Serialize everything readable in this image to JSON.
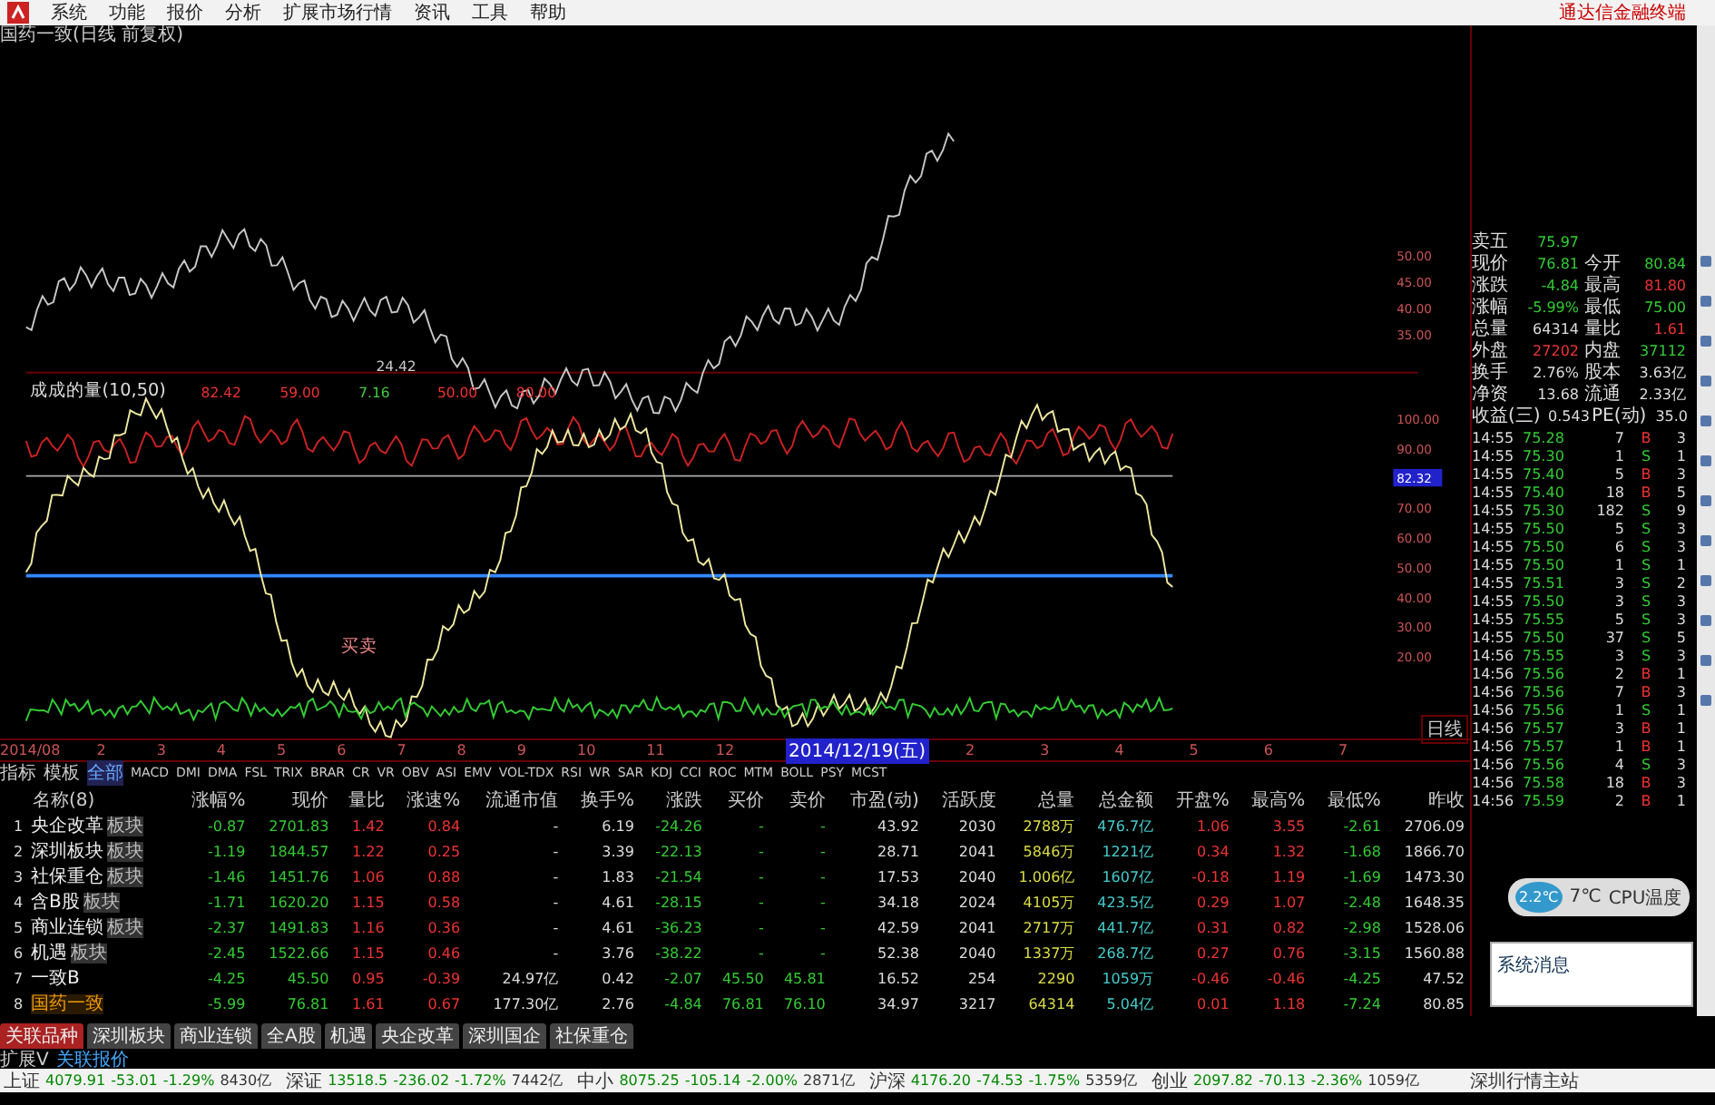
{
  "menu": {
    "items": [
      "系统",
      "功能",
      "报价",
      "分析",
      "扩展市场行情",
      "资讯",
      "工具",
      "帮助"
    ],
    "brand": "通达信金融终端"
  },
  "chart": {
    "title": "国药一致(日线 前复权)",
    "low_label": "24.42",
    "indicator_header": "成成的量(10,50)",
    "indicator_values": [
      "82.42",
      "59.00",
      "7.16",
      "50.00",
      "80.00"
    ],
    "signal_label": "买卖",
    "price_axis": [
      "50.00",
      "45.00",
      "40.00",
      "35.00"
    ],
    "indicator_axis": [
      {
        "label": "100.00",
        "current": false
      },
      {
        "label": "90.00",
        "current": false
      },
      {
        "label": "82.32",
        "current": true
      },
      {
        "label": "70.00",
        "current": false
      },
      {
        "label": "60.00",
        "current": false
      },
      {
        "label": "50.00",
        "current": false
      },
      {
        "label": "40.00",
        "current": false
      },
      {
        "label": "30.00",
        "current": false
      },
      {
        "label": "20.00",
        "current": false
      }
    ],
    "period_label": "日线"
  },
  "date_axis": {
    "start": "2014/08",
    "marks": [
      "2",
      "3",
      "4",
      "5",
      "6",
      "7",
      "8",
      "9",
      "10",
      "11",
      "12"
    ],
    "cursor_date": "2014/12/19(五)",
    "after": [
      "2",
      "3",
      "4",
      "5",
      "6",
      "7"
    ]
  },
  "indicator_tabs": [
    {
      "label": "指标",
      "selected": false
    },
    {
      "label": "模板",
      "selected": false
    },
    {
      "label": "全部",
      "selected": true
    },
    {
      "label": "MACD",
      "selected": false
    },
    {
      "label": "DMI",
      "selected": false
    },
    {
      "label": "DMA",
      "selected": false
    },
    {
      "label": "FSL",
      "selected": false
    },
    {
      "label": "TRIX",
      "selected": false
    },
    {
      "label": "BRAR",
      "selected": false
    },
    {
      "label": "CR",
      "selected": false
    },
    {
      "label": "VR",
      "selected": false
    },
    {
      "label": "OBV",
      "selected": false
    },
    {
      "label": "ASI",
      "selected": false
    },
    {
      "label": "EMV",
      "selected": false
    },
    {
      "label": "VOL-TDX",
      "selected": false
    },
    {
      "label": "RSI",
      "selected": false
    },
    {
      "label": "WR",
      "selected": false
    },
    {
      "label": "SAR",
      "selected": false
    },
    {
      "label": "KDJ",
      "selected": false
    },
    {
      "label": "CCI",
      "selected": false
    },
    {
      "label": "ROC",
      "selected": false
    },
    {
      "label": "MTM",
      "selected": false
    },
    {
      "label": "BOLL",
      "selected": false
    },
    {
      "label": "PSY",
      "selected": false
    },
    {
      "label": "MCST",
      "selected": false
    }
  ],
  "table": {
    "columns": [
      "名称(8)",
      "涨幅%",
      "现价",
      "量比",
      "涨速%",
      "流通市值",
      "换手%",
      "涨跌",
      "买价",
      "卖价",
      "市盈(动)",
      "活跃度",
      "总量",
      "总金额",
      "开盘%",
      "最高%",
      "最低%",
      "昨收"
    ],
    "rows": [
      {
        "index": "1",
        "tag": "板块",
        "selected": false,
        "cells": [
          "央企改革",
          "-0.87",
          "2701.83",
          "1.42",
          "0.84",
          "-",
          "6.19",
          "-24.26",
          "-",
          "-",
          "43.92",
          "2030",
          "2788万",
          "476.7亿",
          "1.06",
          "3.55",
          "-2.61",
          "2706.09"
        ]
      },
      {
        "index": "2",
        "tag": "板块",
        "selected": false,
        "cells": [
          "深圳板块",
          "-1.19",
          "1844.57",
          "1.22",
          "0.25",
          "-",
          "3.39",
          "-22.13",
          "-",
          "-",
          "28.71",
          "2041",
          "5846万",
          "1221亿",
          "0.34",
          "1.32",
          "-1.68",
          "1866.70"
        ]
      },
      {
        "index": "3",
        "tag": "板块",
        "selected": false,
        "cells": [
          "社保重仓",
          "-1.46",
          "1451.76",
          "1.06",
          "0.88",
          "-",
          "1.83",
          "-21.54",
          "-",
          "-",
          "17.53",
          "2040",
          "1.006亿",
          "1607亿",
          "-0.18",
          "1.19",
          "-1.69",
          "1473.30"
        ]
      },
      {
        "index": "4",
        "tag": "板块",
        "selected": false,
        "cells": [
          "含B股",
          "-1.71",
          "1620.20",
          "1.15",
          "0.58",
          "-",
          "4.61",
          "-28.15",
          "-",
          "-",
          "34.18",
          "2024",
          "4105万",
          "423.5亿",
          "0.29",
          "1.07",
          "-2.48",
          "1648.35"
        ]
      },
      {
        "index": "5",
        "tag": "板块",
        "selected": false,
        "cells": [
          "商业连锁",
          "-2.37",
          "1491.83",
          "1.16",
          "0.36",
          "-",
          "4.61",
          "-36.23",
          "-",
          "-",
          "42.59",
          "2041",
          "2717万",
          "441.7亿",
          "0.31",
          "0.82",
          "-2.98",
          "1528.06"
        ]
      },
      {
        "index": "6",
        "tag": "板块",
        "selected": false,
        "cells": [
          "机遇",
          "-2.45",
          "1522.66",
          "1.15",
          "0.46",
          "-",
          "3.76",
          "-38.22",
          "-",
          "-",
          "52.38",
          "2040",
          "1337万",
          "268.7亿",
          "0.27",
          "0.76",
          "-3.15",
          "1560.88"
        ]
      },
      {
        "index": "7",
        "selected": false,
        "cells": [
          "一致B",
          "-4.25",
          "45.50",
          "0.95",
          "-0.39",
          "24.97亿",
          "0.42",
          "-2.07",
          "45.50",
          "45.81",
          "16.52",
          "254",
          "2290",
          "1059万",
          "-0.46",
          "-0.46",
          "-4.25",
          "47.52"
        ]
      },
      {
        "index": "8",
        "selected": true,
        "cells": [
          "国药一致",
          "-5.99",
          "76.81",
          "1.61",
          "0.67",
          "177.30亿",
          "2.76",
          "-4.84",
          "76.81",
          "76.10",
          "34.97",
          "3217",
          "64314",
          "5.04亿",
          "0.01",
          "1.18",
          "-7.24",
          "80.85"
        ]
      }
    ]
  },
  "bottom_tabs": [
    {
      "label": "关联品种",
      "selected": true
    },
    {
      "label": "深圳板块",
      "selected": false
    },
    {
      "label": "商业连锁",
      "selected": false
    },
    {
      "label": "全A股",
      "selected": false
    },
    {
      "label": "机遇",
      "selected": false
    },
    {
      "label": "央企改革",
      "selected": false
    },
    {
      "label": "深圳国企",
      "selected": false
    },
    {
      "label": "社保重仓",
      "selected": false
    }
  ],
  "sub_bar": [
    "扩展V",
    "关联报价"
  ],
  "status_bar": {
    "indices": [
      {
        "name": "上证",
        "value": "4079.91",
        "change": "-53.01",
        "percent": "-1.29%",
        "amount": "8430亿"
      },
      {
        "name": "深证",
        "value": "13518.5",
        "change": "-236.02",
        "percent": "-1.72%",
        "amount": "7442亿"
      },
      {
        "name": "中小",
        "value": "8075.25",
        "change": "-105.14",
        "percent": "-2.00%",
        "amount": "2871亿"
      },
      {
        "name": "沪深",
        "value": "4176.20",
        "change": "-74.53",
        "percent": "-1.75%",
        "amount": "5359亿"
      },
      {
        "name": "创业",
        "value": "2097.82",
        "change": "-70.13",
        "percent": "-2.36%",
        "amount": "1059亿"
      }
    ],
    "server": "深圳行情主站"
  },
  "quote": {
    "rows": [
      {
        "items": [
          {
            "label": "卖五",
            "value": "75.97",
            "color": "#33cc33"
          }
        ]
      },
      {
        "items": [
          {
            "label": "现价",
            "value": "76.81",
            "color": "#33cc33"
          },
          {
            "label": "今开",
            "value": "80.84",
            "color": "#33cc33"
          }
        ]
      },
      {
        "items": [
          {
            "label": "涨跌",
            "value": "-4.84",
            "color": "#33cc33"
          },
          {
            "label": "最高",
            "value": "81.80",
            "color": "#ee3333"
          }
        ]
      },
      {
        "items": [
          {
            "label": "涨幅",
            "value": "-5.99%",
            "color": "#33cc33"
          },
          {
            "label": "最低",
            "value": "75.00",
            "color": "#33cc33"
          }
        ]
      },
      {
        "items": [
          {
            "label": "总量",
            "value": "64314",
            "color": "#dddddd"
          },
          {
            "label": "量比",
            "value": "1.61",
            "color": "#ee3333"
          }
        ]
      },
      {
        "items": [
          {
            "label": "外盘",
            "value": "27202",
            "color": "#ee3333"
          },
          {
            "label": "内盘",
            "value": "37112",
            "color": "#33cc33"
          }
        ]
      },
      {
        "items": [
          {
            "label": "换手",
            "value": "2.76%",
            "color": "#dddddd"
          },
          {
            "label": "股本",
            "value": "3.63亿",
            "color": "#dddddd"
          }
        ]
      },
      {
        "items": [
          {
            "label": "净资",
            "value": "13.68",
            "color": "#dddddd"
          },
          {
            "label": "流通",
            "value": "2.33亿",
            "color": "#dddddd"
          }
        ]
      },
      {
        "items": [
          {
            "label": "收益(三)",
            "value": "0.543",
            "color": "#dddddd"
          },
          {
            "label": "PE(动)",
            "value": "35.0",
            "color": "#dddddd"
          }
        ]
      }
    ]
  },
  "trades": [
    {
      "time": "14:55",
      "price": "75.28",
      "volume": "7",
      "side": "B",
      "kind": "buy",
      "count": "3"
    },
    {
      "time": "14:55",
      "price": "75.30",
      "volume": "1",
      "side": "S",
      "kind": "sell",
      "count": "1"
    },
    {
      "time": "14:55",
      "price": "75.40",
      "volume": "5",
      "side": "B",
      "kind": "buy",
      "count": "3"
    },
    {
      "time": "14:55",
      "price": "75.40",
      "volume": "18",
      "side": "B",
      "kind": "buy",
      "count": "5"
    },
    {
      "time": "14:55",
      "price": "75.30",
      "volume": "182",
      "side": "S",
      "kind": "sell",
      "count": "9"
    },
    {
      "time": "14:55",
      "price": "75.50",
      "volume": "5",
      "side": "S",
      "kind": "sell",
      "count": "3"
    },
    {
      "time": "14:55",
      "price": "75.50",
      "volume": "6",
      "side": "S",
      "kind": "sell",
      "count": "3"
    },
    {
      "time": "14:55",
      "price": "75.50",
      "volume": "1",
      "side": "S",
      "kind": "sell",
      "count": "1"
    },
    {
      "time": "14:55",
      "price": "75.51",
      "volume": "3",
      "side": "S",
      "kind": "sell",
      "count": "2"
    },
    {
      "time": "14:55",
      "price": "75.50",
      "volume": "3",
      "side": "S",
      "kind": "sell",
      "count": "3"
    },
    {
      "time": "14:55",
      "price": "75.55",
      "volume": "5",
      "side": "S",
      "kind": "sell",
      "count": "3"
    },
    {
      "time": "14:55",
      "price": "75.50",
      "volume": "37",
      "side": "S",
      "kind": "sell",
      "count": "5"
    },
    {
      "time": "14:56",
      "price": "75.55",
      "volume": "3",
      "side": "S",
      "kind": "sell",
      "count": "3"
    },
    {
      "time": "14:56",
      "price": "75.56",
      "volume": "2",
      "side": "B",
      "kind": "buy",
      "count": "1"
    },
    {
      "time": "14:56",
      "price": "75.56",
      "volume": "7",
      "side": "B",
      "kind": "buy",
      "count": "3"
    },
    {
      "time": "14:56",
      "price": "75.56",
      "volume": "1",
      "side": "S",
      "kind": "sell",
      "count": "1"
    },
    {
      "time": "14:56",
      "price": "75.57",
      "volume": "3",
      "side": "B",
      "kind": "buy",
      "count": "1"
    },
    {
      "time": "14:56",
      "price": "75.57",
      "volume": "1",
      "side": "B",
      "kind": "buy",
      "count": "1"
    },
    {
      "time": "14:56",
      "price": "75.56",
      "volume": "4",
      "side": "S",
      "kind": "sell",
      "count": "3"
    },
    {
      "time": "14:56",
      "price": "75.58",
      "volume": "18",
      "side": "B",
      "kind": "buy",
      "count": "3"
    },
    {
      "time": "14:56",
      "price": "75.59",
      "volume": "2",
      "side": "B",
      "kind": "buy",
      "count": "1"
    }
  ],
  "widget": {
    "value": "2.2℃",
    "temp": "7℃",
    "label": "CPU温度"
  },
  "popup": {
    "title": "系统消息"
  }
}
